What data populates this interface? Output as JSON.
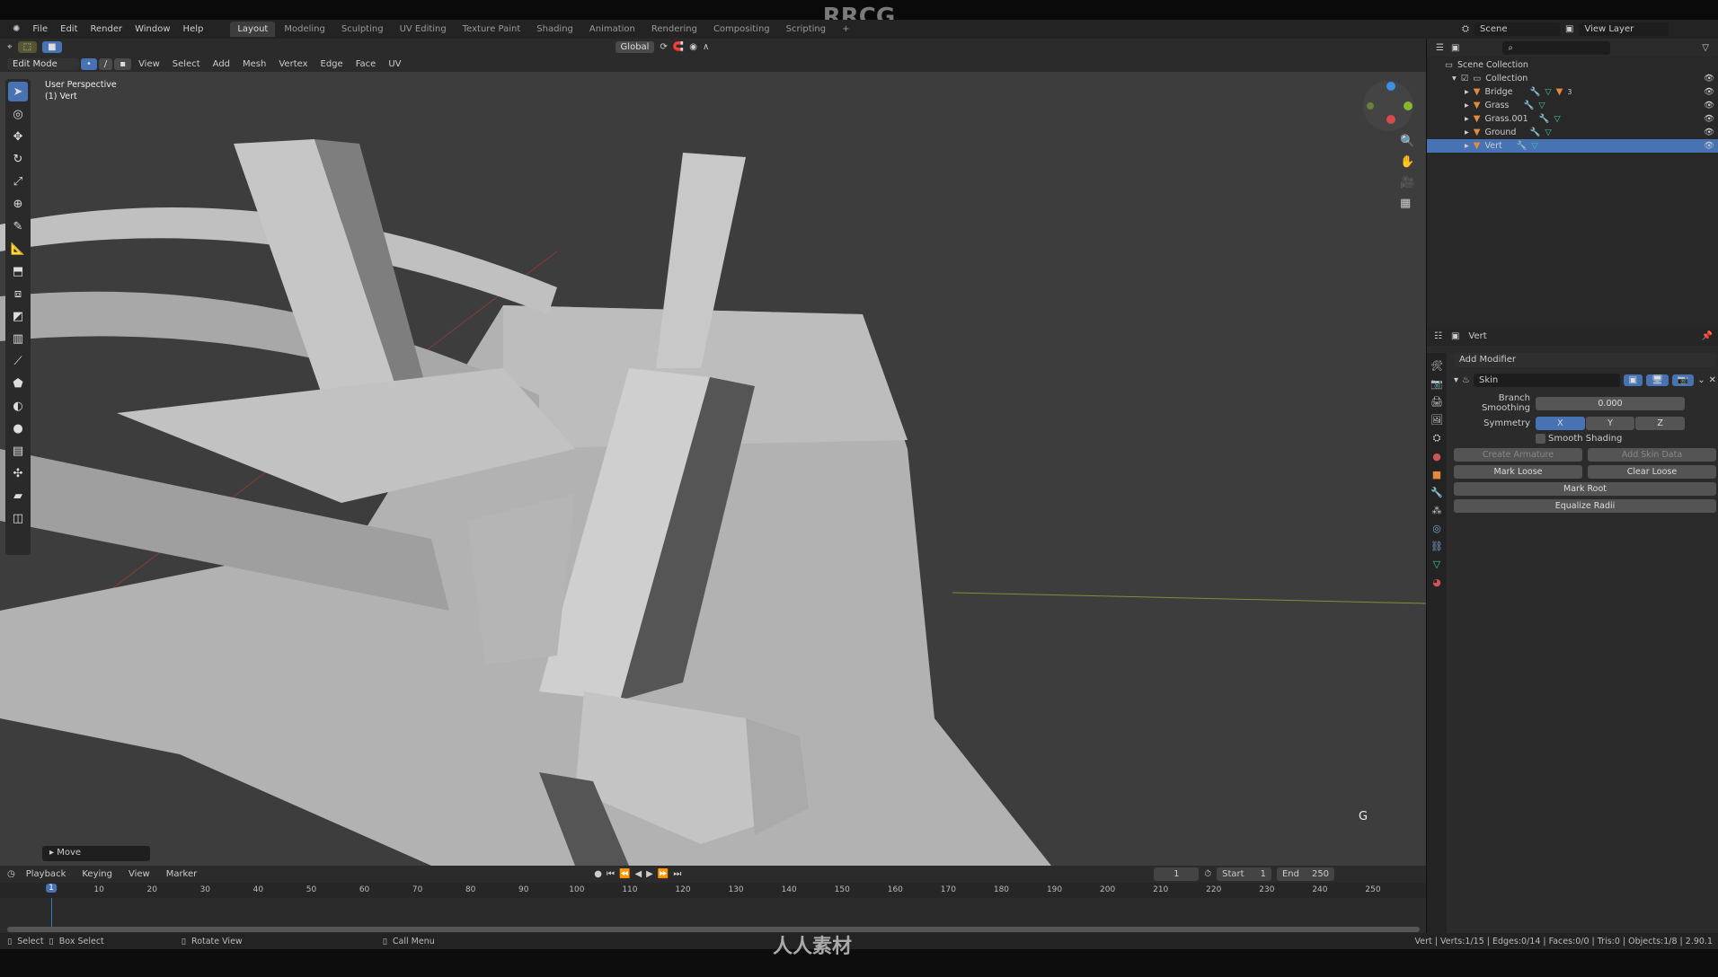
{
  "watermark": "RRCG",
  "bottom_watermark": "人人素材",
  "menu": [
    "File",
    "Edit",
    "Render",
    "Window",
    "Help"
  ],
  "workspaces": [
    "Layout",
    "Modeling",
    "Sculpting",
    "UV Editing",
    "Texture Paint",
    "Shading",
    "Animation",
    "Rendering",
    "Compositing",
    "Scripting",
    "+"
  ],
  "active_workspace": "Layout",
  "scene": {
    "scene_name": "Scene",
    "view_layer": "View Layer"
  },
  "tool_header": {
    "orientation": "Global"
  },
  "mode_header": {
    "mode": "Edit Mode",
    "menus": [
      "View",
      "Select",
      "Add",
      "Mesh",
      "Vertex",
      "Edge",
      "Face",
      "UV"
    ]
  },
  "viewport": {
    "view_name": "User Perspective",
    "object_info": "(1) Vert",
    "key_hint": "G",
    "last_operator": "Move"
  },
  "outliner": {
    "root": "Scene Collection",
    "collection": "Collection",
    "objects": [
      {
        "name": "Bridge",
        "selected": false,
        "extra": "3"
      },
      {
        "name": "Grass",
        "selected": false
      },
      {
        "name": "Grass.001",
        "selected": false
      },
      {
        "name": "Ground",
        "selected": false
      },
      {
        "name": "Vert",
        "selected": true
      }
    ]
  },
  "properties": {
    "object_name": "Vert",
    "add_modifier": "Add Modifier",
    "modifier_name": "Skin",
    "branch_smoothing_label": "Branch Smoothing",
    "branch_smoothing_value": "0.000",
    "symmetry_label": "Symmetry",
    "symmetry": [
      "X",
      "Y",
      "Z"
    ],
    "symmetry_active": "X",
    "smooth_shading_label": "Smooth Shading",
    "smooth_shading": false,
    "buttons": {
      "create_armature": "Create Armature",
      "add_skin_data": "Add Skin Data",
      "mark_loose": "Mark Loose",
      "clear_loose": "Clear Loose",
      "mark_root": "Mark Root",
      "equalize_radii": "Equalize Radii"
    }
  },
  "timeline": {
    "menus": [
      "Playback",
      "Keying",
      "View",
      "Marker"
    ],
    "current_frame": "1",
    "start_label": "Start",
    "start": "1",
    "end_label": "End",
    "end": "250",
    "ticks": [
      "10",
      "20",
      "30",
      "40",
      "50",
      "60",
      "70",
      "80",
      "90",
      "100",
      "110",
      "120",
      "130",
      "140",
      "150",
      "160",
      "170",
      "180",
      "190",
      "200",
      "210",
      "220",
      "230",
      "240",
      "250"
    ]
  },
  "status": {
    "select": "Select",
    "box_select": "Box Select",
    "rotate_view": "Rotate View",
    "call_menu": "Call Menu",
    "stats": "Vert | Verts:1/15 | Edges:0/14 | Faces:0/0 | Tris:0 | Objects:1/8 | 2.90.1"
  },
  "colors": {
    "accent": "#4772b3",
    "viewport_bg": "#3d3d3d",
    "mesh_grey": "#b8b8b8"
  }
}
